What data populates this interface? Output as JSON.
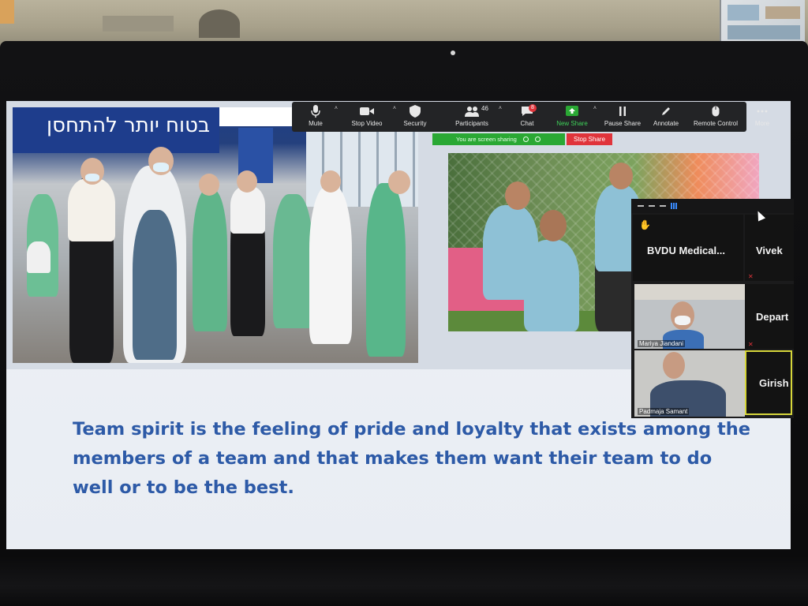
{
  "toolbar": {
    "mute": "Mute",
    "stop_video": "Stop Video",
    "security": "Security",
    "participants": "Participants",
    "participants_count": "46",
    "chat": "Chat",
    "chat_badge": "8",
    "new_share": "New Share",
    "pause_share": "Pause Share",
    "annotate": "Annotate",
    "remote_control": "Remote Control",
    "more": "More"
  },
  "share_status": {
    "sharing_text": "You are screen sharing",
    "stop_share": "Stop Share"
  },
  "slide": {
    "banner_text": "בטוח יותר להתחסן",
    "body_text": "Team spirit is the feeling of pride and loyalty that exists among the members of a team and that makes them want their team to do well or to be the best."
  },
  "participants_panel": {
    "tiles": [
      {
        "name": "BVDU  Medical..."
      },
      {
        "name": "Vivek"
      },
      {
        "name": "Mariya Jiandani"
      },
      {
        "name": "Depart"
      },
      {
        "name": "Padmaja Samant"
      },
      {
        "name": "Girish"
      }
    ]
  },
  "colors": {
    "slide_text": "#2d5aa7",
    "toolbar_bg": "#232426",
    "sharing_green": "#2aa834",
    "stop_red": "#e0343b",
    "active_speaker_border": "#d6d63a"
  }
}
